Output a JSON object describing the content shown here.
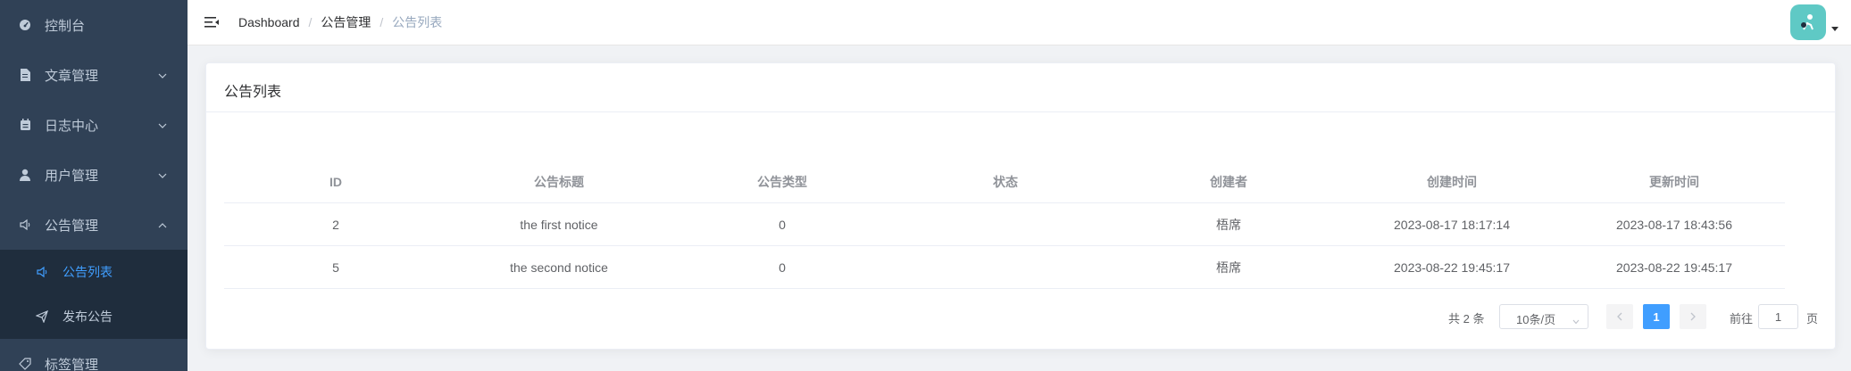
{
  "sidebar": {
    "items": [
      {
        "label": "控制台",
        "icon": "dashboard-icon"
      },
      {
        "label": "文章管理",
        "icon": "document-icon"
      },
      {
        "label": "日志中心",
        "icon": "log-icon"
      },
      {
        "label": "用户管理",
        "icon": "user-icon"
      },
      {
        "label": "公告管理",
        "icon": "speaker-icon"
      },
      {
        "label": "标签管理",
        "icon": "tag-icon"
      }
    ],
    "submenu": [
      {
        "label": "公告列表",
        "icon": "speaker-icon",
        "active": true
      },
      {
        "label": "发布公告",
        "icon": "send-icon",
        "active": false
      }
    ]
  },
  "navbar": {
    "breadcrumb": [
      "Dashboard",
      "公告管理",
      "公告列表"
    ]
  },
  "card": {
    "title": "公告列表"
  },
  "table": {
    "headers": [
      "ID",
      "公告标题",
      "公告类型",
      "状态",
      "创建者",
      "创建时间",
      "更新时间"
    ],
    "rows": [
      [
        "2",
        "the first notice",
        "0",
        "",
        "梧席",
        "2023-08-17 18:17:14",
        "2023-08-17 18:43:56"
      ],
      [
        "5",
        "the second notice",
        "0",
        "",
        "梧席",
        "2023-08-22 19:45:17",
        "2023-08-22 19:45:17"
      ]
    ]
  },
  "pagination": {
    "total_text": "共 2 条",
    "page_size": "10条/页",
    "current_page": "1",
    "jumper_label": "前往",
    "jumper_value": "1",
    "jumper_suffix": "页"
  },
  "colors": {
    "sidebar_bg": "#304156",
    "submenu_bg": "#1f2d3d",
    "accent": "#409eff",
    "avatar_bg": "#5fc9c5"
  }
}
